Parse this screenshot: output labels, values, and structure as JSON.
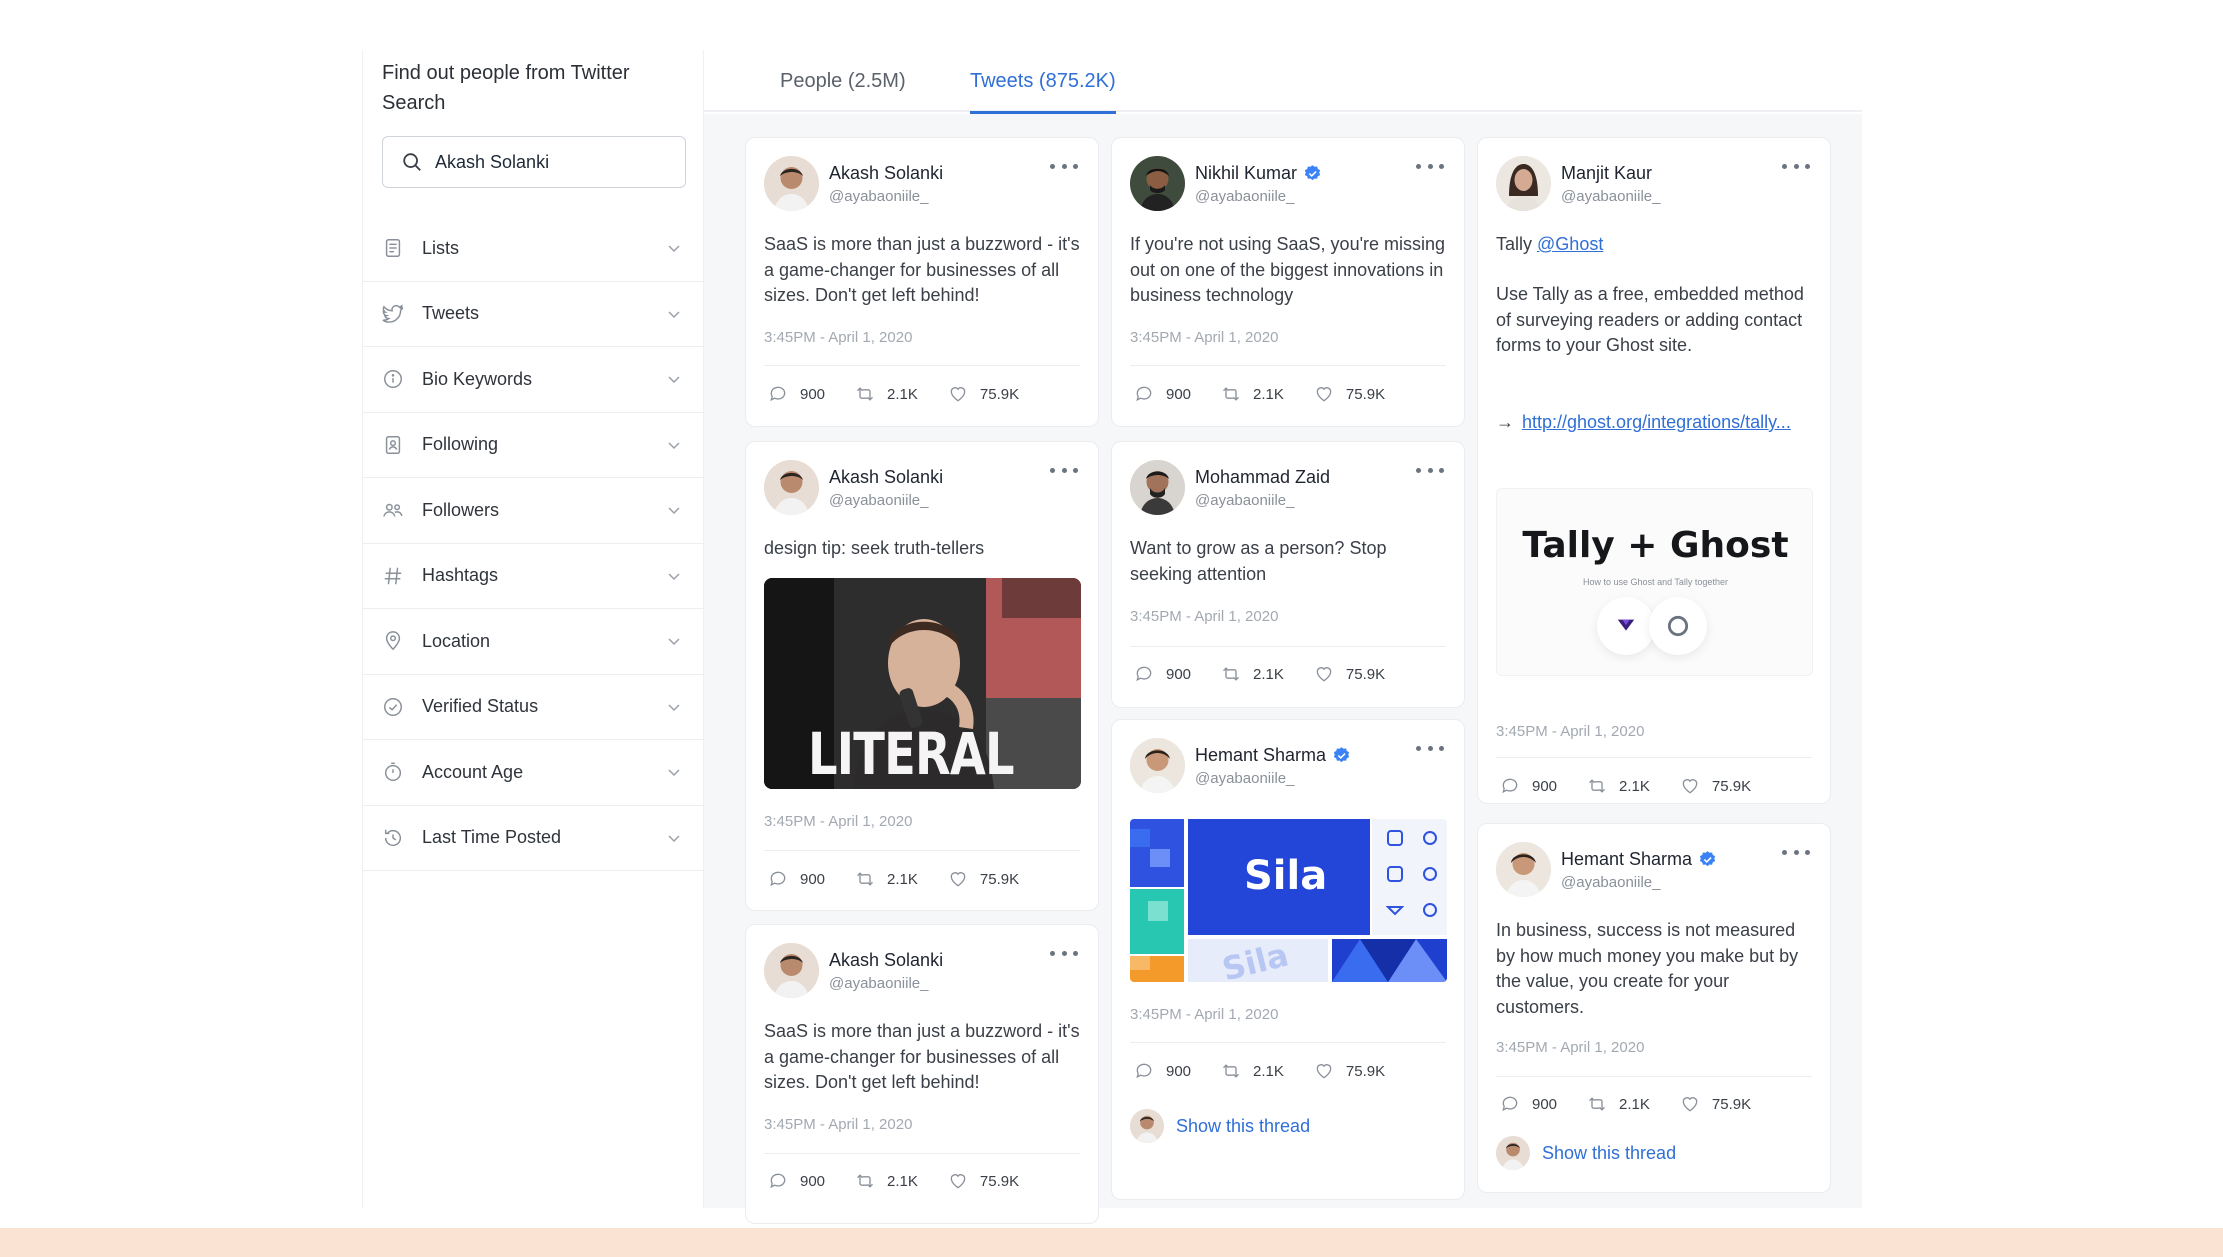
{
  "sidebar": {
    "title": "Find out people from Twitter Search",
    "search_value": "Akash Solanki",
    "filters": [
      {
        "label": "Lists",
        "icon": "document-icon"
      },
      {
        "label": "Tweets",
        "icon": "bird-icon"
      },
      {
        "label": "Bio Keywords",
        "icon": "info-icon"
      },
      {
        "label": "Following",
        "icon": "contact-icon"
      },
      {
        "label": "Followers",
        "icon": "users-icon"
      },
      {
        "label": "Hashtags",
        "icon": "hash-icon"
      },
      {
        "label": "Location",
        "icon": "location-icon"
      },
      {
        "label": "Verified Status",
        "icon": "check-circle-icon"
      },
      {
        "label": "Account Age",
        "icon": "stopwatch-icon"
      },
      {
        "label": "Last Time Posted",
        "icon": "history-icon"
      }
    ]
  },
  "tabs": [
    {
      "label": "People (2.5M)",
      "active": false
    },
    {
      "label": "Tweets (875.2K)",
      "active": true
    }
  ],
  "tweets": {
    "c1": {
      "name": "Akash Solanki",
      "handle": "@ayabaoniile_",
      "text": "SaaS is more than just a buzzword - it's a game-changer for businesses of all sizes. Don't get left behind!",
      "time": "3:45PM - April 1, 2020",
      "replies": "900",
      "retweets": "2.1K",
      "likes": "75.9K"
    },
    "c2": {
      "name": "Akash Solanki",
      "handle": "@ayabaoniile_",
      "text": "design tip: seek truth-tellers",
      "image_caption": "LITERAL",
      "time": "3:45PM - April 1, 2020",
      "replies": "900",
      "retweets": "2.1K",
      "likes": "75.9K"
    },
    "c3": {
      "name": "Akash Solanki",
      "handle": "@ayabaoniile_",
      "text": "SaaS is more than just a buzzword - it's a game-changer for businesses of all sizes. Don't get left behind!",
      "time": "3:45PM - April 1, 2020",
      "replies": "900",
      "retweets": "2.1K",
      "likes": "75.9K"
    },
    "c4": {
      "name": "Nikhil Kumar",
      "handle": "@ayabaoniile_",
      "text": "If you're not using SaaS, you're missing out on one of the biggest innovations in business technology",
      "time": "3:45PM - April 1, 2020",
      "replies": "900",
      "retweets": "2.1K",
      "likes": "75.9K"
    },
    "c5": {
      "name": "Mohammad Zaid",
      "handle": "@ayabaoniile_",
      "text": "Want to grow as a person? Stop seeking attention",
      "time": "3:45PM - April 1, 2020",
      "replies": "900",
      "retweets": "2.1K",
      "likes": "75.9K"
    },
    "c6": {
      "name": "Hemant Sharma",
      "handle": "@ayabaoniile_",
      "image_brand": "Sila",
      "image_brand_2": "Sila",
      "time": "3:45PM - April 1, 2020",
      "replies": "900",
      "retweets": "2.1K",
      "likes": "75.9K",
      "thread": "Show this thread"
    },
    "c7": {
      "name": "Manjit Kaur",
      "handle": "@ayabaoniile_",
      "text_prefix": "Tally",
      "mention": "@Ghost",
      "text": "Use Tally as a free, embedded method of surveying readers or adding contact forms to your Ghost site.",
      "arrow": "→",
      "url": "http://ghost.org/integrations/tally...",
      "image_title": "Tally + Ghost",
      "image_subtitle": "How to use Ghost and Tally together",
      "time": "3:45PM - April 1, 2020",
      "replies": "900",
      "retweets": "2.1K",
      "likes": "75.9K"
    },
    "c8": {
      "name": "Hemant Sharma",
      "handle": "@ayabaoniile_",
      "text": "In business, success is not measured by how much money you make but by the value, you create for your customers.",
      "time": "3:45PM - April 1, 2020",
      "replies": "900",
      "retweets": "2.1K",
      "likes": "75.9K",
      "thread": "Show this thread"
    }
  },
  "colors": {
    "accent": "#2f6fd6",
    "verified": "#3b82f6",
    "bottom_band": "#fbe3d3"
  }
}
